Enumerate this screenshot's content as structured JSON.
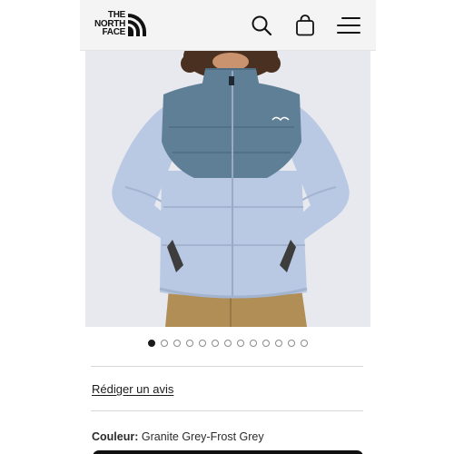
{
  "brand": {
    "logo_lines": [
      "THE",
      "NORTH",
      "FACE"
    ]
  },
  "header": {
    "icons": [
      "search-icon",
      "shopping-bag-icon",
      "hamburger-menu-icon"
    ]
  },
  "product": {
    "image_alt": "Puffer jacket",
    "colors": {
      "upper": "#5f7f97",
      "lower": "#b9c9e3",
      "background": "#e7e9ee",
      "pants": "#b08e55"
    }
  },
  "carousel": {
    "total_slides": 13,
    "active_index": 0
  },
  "review": {
    "link_label": "Rédiger un avis"
  },
  "color_selection": {
    "label": "Couleur:",
    "value": "Granite Grey-Frost Grey"
  }
}
